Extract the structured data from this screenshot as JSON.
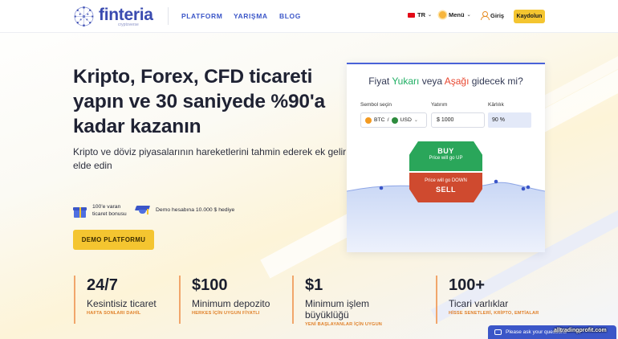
{
  "header": {
    "brand": "finteria",
    "brand_sub": "cryptoverse",
    "nav": [
      "PLATFORM",
      "YARIŞMA",
      "BLOG"
    ],
    "lang": "TR",
    "menu": "Menü",
    "login": "Giriş",
    "register": "Kaydolun"
  },
  "hero": {
    "title": "Kripto, Forex, CFD ticareti yapın ve 30 saniyede %90'a kadar kazanın",
    "subtitle": "Kripto ve döviz piyasalarının hareketlerini tahmin ederek ek gelir elde edin",
    "feature_bonus_line1": "100'e varan",
    "feature_bonus_line2": "ticaret bonusu",
    "feature_demo": "Demo hesabına 10.000 $ hediye",
    "demo_button": "DEMO PLATFORMU"
  },
  "trade_card": {
    "question_prefix": "Fiyat ",
    "question_up": "Yukarı",
    "question_mid": " veya ",
    "question_down": "Aşağı",
    "question_suffix": " gidecek mi?",
    "symbol_label": "Sembol seçin",
    "symbol_base": "BTC",
    "symbol_sep": "/",
    "symbol_quote": "USD",
    "amount_label": "Yatırım",
    "amount_value": "$ 1000",
    "profit_label": "Kârlılık",
    "profit_value": "90 %",
    "buy_label": "BUY",
    "buy_sub": "Price will go UP",
    "sell_sub": "Price will go DOWN",
    "sell_label": "SELL"
  },
  "stats": [
    {
      "value": "24/7",
      "label": "Kesintisiz ticaret",
      "note": "HAFTA SONLARI DAHİL"
    },
    {
      "value": "$100",
      "label": "Minimum depozito",
      "note": "HERKES İÇİN UYGUN FİYATLI"
    },
    {
      "value": "$1",
      "label": "Minimum işlem büyüklüğü",
      "note": "YENİ BAŞLAYANLAR İÇİN UYGUN"
    },
    {
      "value": "100+",
      "label": "Ticari varlıklar",
      "note": "HİSSE SENETLERİ, KRİPTO, EMTİALAR"
    }
  ],
  "chat": {
    "text": "Please ask your questions"
  },
  "watermark": "alltradingprofit.com",
  "colors": {
    "accent": "#3b56c8",
    "yellow": "#f4c530",
    "buy": "#2aa65a",
    "sell": "#cf4a2f",
    "stat_note": "#e0802a"
  }
}
